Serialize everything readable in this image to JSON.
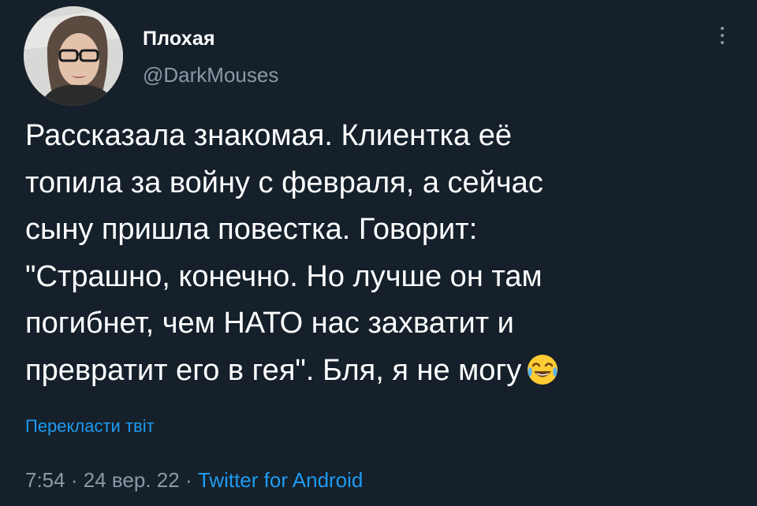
{
  "author": {
    "display_name": "Плохая",
    "handle": "@DarkMouses",
    "avatar_icon": "profile-photo"
  },
  "tweet": {
    "lines": [
      "Рассказала знакомая. Клиентка её",
      "топила за войну с февраля, а сейчас",
      "сыну пришла повестка. Говорит:",
      "\"Страшно, конечно. Но лучше он там",
      "погибнет, чем НАТО нас захватит и",
      "превратит его в гея\". Бля, я не могу"
    ],
    "emoji": "face-with-tears-of-joy"
  },
  "translate_label": "Перекласти твіт",
  "meta": {
    "time": "7:54",
    "separator": "·",
    "date": "24 вер. 22",
    "source": "Twitter for Android"
  },
  "colors": {
    "background": "#15202b",
    "text": "#ffffff",
    "secondary": "#8b98a5",
    "accent": "#1d9bf0"
  }
}
